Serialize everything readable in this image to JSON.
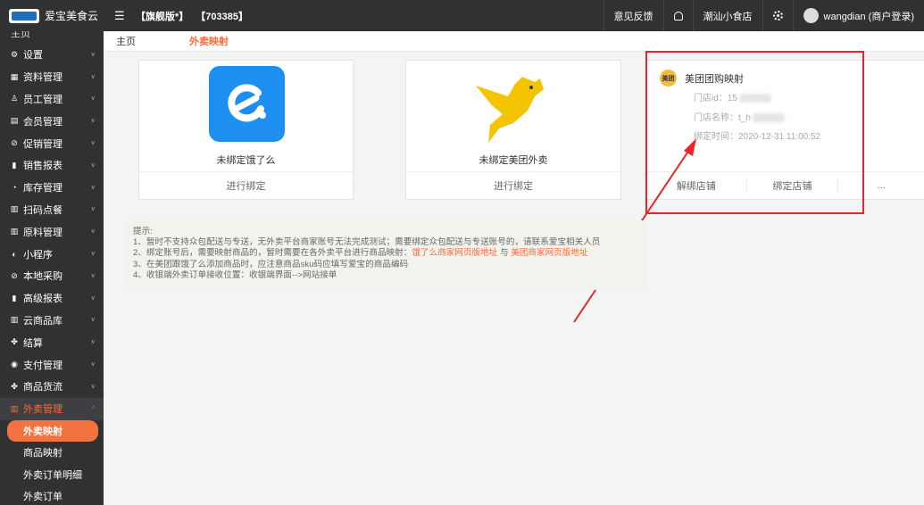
{
  "header": {
    "app_name": "爱宝美食云",
    "edition": "【旗舰版*】",
    "store_code": "【703385】",
    "feedback": "意见反馈",
    "store_name": "潮汕小食店",
    "user": "wangdian (商户登录)"
  },
  "sidebar": {
    "top_cut": "主页",
    "items": [
      {
        "label": "设置",
        "icon": "⚙"
      },
      {
        "label": "资料管理",
        "icon": "▦"
      },
      {
        "label": "员工管理",
        "icon": "♙"
      },
      {
        "label": "会员管理",
        "icon": "▤"
      },
      {
        "label": "促销管理",
        "icon": "⊘"
      },
      {
        "label": "销售报表",
        "icon": "▮"
      },
      {
        "label": "库存管理",
        "icon": "◔"
      },
      {
        "label": "扫码点餐",
        "icon": "▥"
      },
      {
        "label": "原料管理",
        "icon": "▥"
      },
      {
        "label": "小程序",
        "icon": "◐"
      },
      {
        "label": "本地采购",
        "icon": "⊘"
      },
      {
        "label": "高级报表",
        "icon": "▮"
      },
      {
        "label": "云商品库",
        "icon": "▥"
      },
      {
        "label": "结算",
        "icon": "✤"
      },
      {
        "label": "支付管理",
        "icon": "◉"
      },
      {
        "label": "商品货流",
        "icon": "✤"
      },
      {
        "label": "外卖管理",
        "icon": "▥"
      }
    ],
    "sub_items": [
      "外卖映射",
      "商品映射",
      "外卖订单明细",
      "外卖订单"
    ]
  },
  "tabs": {
    "home": "主页",
    "current": "外卖映射"
  },
  "cards": {
    "eleme": {
      "title": "未绑定饿了么",
      "action": "进行绑定"
    },
    "meituan_waimai": {
      "title": "未绑定美团外卖",
      "action": "进行绑定"
    },
    "meituan_group": {
      "badge": "美团",
      "title": "美团团购映射",
      "store_id_label": "门店id：15",
      "store_name_label": "门店名称：t_h",
      "bind_time": "绑定时间：2020-12-31 11:00:52",
      "unbind": "解绑店铺",
      "bind": "绑定店铺",
      "more": "..."
    }
  },
  "tips": {
    "title": "提示:",
    "line1": "1、暂时不支持众包配送与专送，无外卖平台商家账号无法完成测试；需要绑定众包配送与专送账号的，请联系爱宝相关人员",
    "line2_prefix": "2、绑定账号后，需要映射商品的，暂时需要在各外卖平台进行商品映射：",
    "link_eleme": "饿了么商家网页版地址",
    "and": " 与 ",
    "link_meituan": "美团商家网页版地址",
    "line3": "3、在美团跟饿了么添加商品时，应注意商品sku码应填写爱宝的商品编码",
    "line4": "4、收银端外卖订单接收位置：收银端界面-->网站接单"
  }
}
